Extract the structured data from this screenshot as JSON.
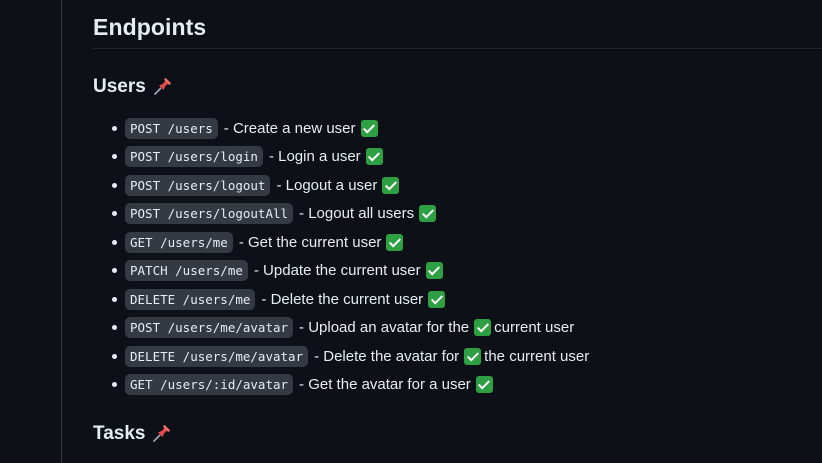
{
  "heading": "Endpoints",
  "sections": {
    "users": {
      "title": "Users"
    },
    "tasks": {
      "title": "Tasks"
    }
  },
  "icons": {
    "pin": "pushpin-icon",
    "check": "check-mark-button-icon"
  },
  "colors": {
    "background": "#0d1117",
    "text": "#e6edf3",
    "code_bg": "#343942",
    "check_green": "#2ea043",
    "pin_red": "#e5484d"
  },
  "endpoints": [
    {
      "route": "POST /users",
      "desc": "- Create a new user",
      "desc_after": ""
    },
    {
      "route": "POST /users/login",
      "desc": "- Login a user",
      "desc_after": ""
    },
    {
      "route": "POST /users/logout",
      "desc": "- Logout a user",
      "desc_after": ""
    },
    {
      "route": "POST /users/logoutAll",
      "desc": "- Logout all users",
      "desc_after": ""
    },
    {
      "route": "GET /users/me",
      "desc": "- Get the current user",
      "desc_after": ""
    },
    {
      "route": "PATCH /users/me",
      "desc": "- Update the current user",
      "desc_after": ""
    },
    {
      "route": "DELETE /users/me",
      "desc": "- Delete the current user",
      "desc_after": ""
    },
    {
      "route": "POST /users/me/avatar",
      "desc": "- Upload an avatar for the",
      "desc_after": "current user"
    },
    {
      "route": "DELETE /users/me/avatar",
      "desc": "- Delete the avatar for",
      "desc_after": "the current user"
    },
    {
      "route": "GET /users/:id/avatar",
      "desc": "- Get the avatar for a user",
      "desc_after": ""
    }
  ]
}
